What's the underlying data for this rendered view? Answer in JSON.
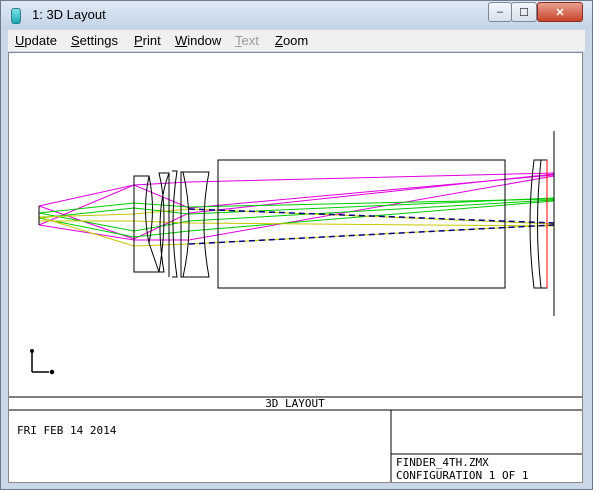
{
  "window": {
    "title": "1: 3D Layout",
    "controls": {
      "minimize": "–",
      "maximize": "☐",
      "close": "✕"
    }
  },
  "menu": {
    "items": [
      {
        "label": "Update",
        "accel": "U",
        "rest": "pdate",
        "enabled": true
      },
      {
        "label": "Settings",
        "accel": "S",
        "rest": "ettings",
        "enabled": true
      },
      {
        "label": "Print",
        "accel": "P",
        "rest": "rint",
        "enabled": true
      },
      {
        "label": "Window",
        "accel": "W",
        "rest": "indow",
        "enabled": true
      },
      {
        "label": "Text",
        "accel": "T",
        "rest": "ext",
        "enabled": false
      },
      {
        "label": "Zoom",
        "accel": "Z",
        "rest": "oom",
        "enabled": true
      }
    ]
  },
  "plot": {
    "banner": "3D LAYOUT",
    "date": "FRI FEB 14 2014",
    "file": "FINDER_4TH.ZMX",
    "configuration": "CONFIGURATION 1 OF 1",
    "ray_colors": {
      "field1": "#e000e0",
      "field2": "#00cc00",
      "field3": "#c8c800",
      "axis": "#000080",
      "surface": "#000000",
      "image": "#ff0000"
    }
  }
}
